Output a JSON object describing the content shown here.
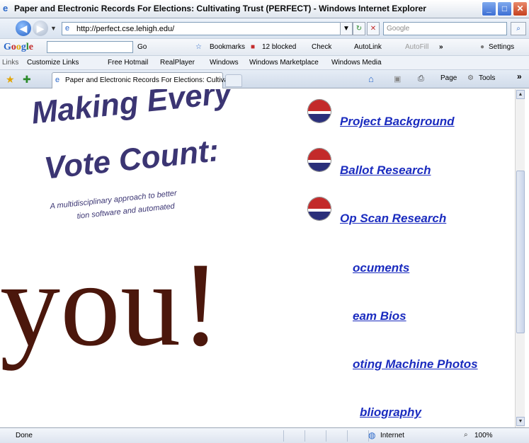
{
  "window": {
    "title": "Paper and Electronic Records For Elections: Cultivating Trust (PERFECT) - Windows Internet Explorer"
  },
  "address_bar": {
    "url": "http://perfect.cse.lehigh.edu/",
    "search_placeholder": "Google"
  },
  "google_toolbar": {
    "go_label": "Go",
    "bookmarks_label": "Bookmarks",
    "blocked_label": "12 blocked",
    "check_label": "Check",
    "autolink_label": "AutoLink",
    "autofill_label": "AutoFill",
    "settings_label": "Settings"
  },
  "links_bar": {
    "label": "Links",
    "items": [
      "Customize Links",
      "Free Hotmail",
      "RealPlayer",
      "Windows",
      "Windows Marketplace",
      "Windows Media"
    ]
  },
  "tabs": {
    "active_tab": "Paper and Electronic Records For Elections: Cultivatin...",
    "page_label": "Page",
    "tools_label": "Tools"
  },
  "hero": {
    "line1": "Making Every",
    "line2": "Vote Count:",
    "sub1": "A multidisciplinary approach to better",
    "sub2": "tion software and automated"
  },
  "nav_links": [
    "Project Background",
    "Ballot Research",
    "Op Scan Research",
    "ocuments",
    "eam Bios",
    "oting Machine Photos",
    "bliography"
  ],
  "overlay": {
    "text": "you!"
  },
  "status": {
    "text": "Done",
    "zone": "Internet",
    "zoom": "100%"
  },
  "colors": {
    "link": "#1b2cbf",
    "hero": "#3b3573",
    "overlay": "#4b170c"
  }
}
